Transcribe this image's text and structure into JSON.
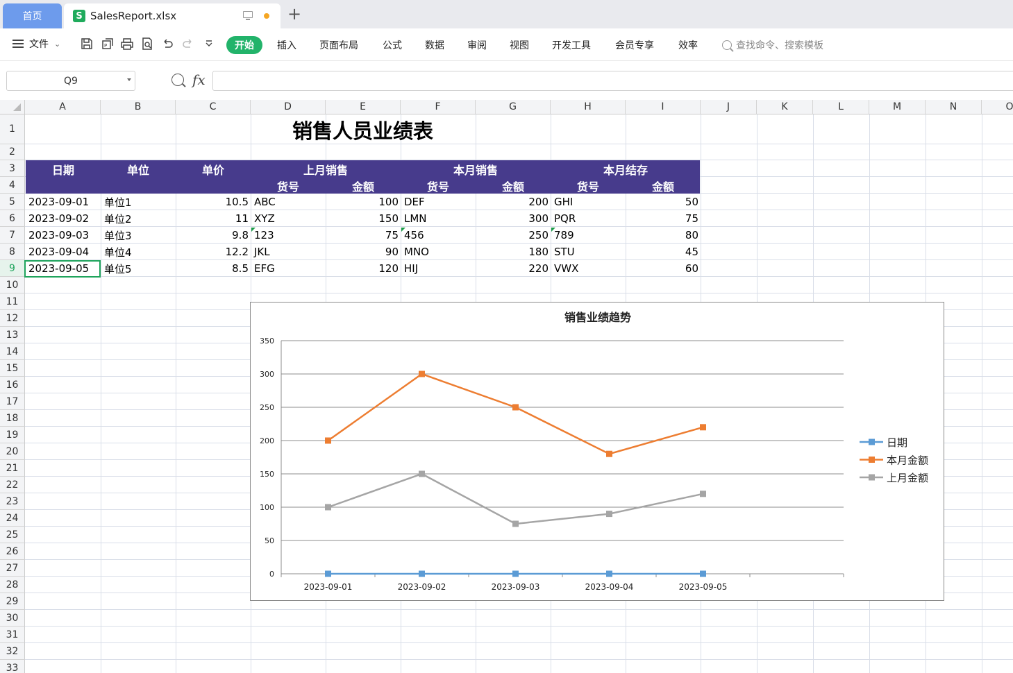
{
  "tabs": {
    "home": "首页",
    "file_name": "SalesReport.xlsx"
  },
  "menu": {
    "file": "文件"
  },
  "ribbon": [
    "开始",
    "插入",
    "页面布局",
    "公式",
    "数据",
    "审阅",
    "视图",
    "开发工具",
    "会员专享",
    "效率"
  ],
  "search": {
    "placeholder": "查找命令、搜索模板"
  },
  "formula_bar": {
    "cell_ref": "Q9",
    "fx": "fx",
    "value": ""
  },
  "columns": [
    "A",
    "B",
    "C",
    "D",
    "E",
    "F",
    "G",
    "H",
    "I",
    "J",
    "K",
    "L",
    "M",
    "N",
    "O"
  ],
  "rows": [
    "1",
    "2",
    "3",
    "4",
    "5",
    "6",
    "7",
    "8",
    "9",
    "10",
    "11",
    "12",
    "13",
    "14",
    "15",
    "16",
    "17",
    "18",
    "19",
    "20",
    "21",
    "22",
    "23",
    "24",
    "25",
    "26",
    "27",
    "28",
    "29",
    "30",
    "31",
    "32",
    "33"
  ],
  "selected_row": "9",
  "sheet": {
    "title": "销售人员业绩表",
    "header_top": {
      "date": "日期",
      "unit": "单位",
      "price": "单价",
      "last_month": "上月销售",
      "this_month": "本月销售",
      "stock": "本月结存"
    },
    "header_sub": {
      "lm_code": "货号",
      "lm_amount": "金额",
      "tm_code": "货号",
      "tm_amount": "金额",
      "st_code": "货号",
      "st_amount": "金额"
    },
    "data_rows": [
      [
        "2023-09-01",
        "单位1",
        "10.5",
        "ABC",
        "100",
        "DEF",
        "200",
        "GHI",
        "50"
      ],
      [
        "2023-09-02",
        "单位2",
        "11",
        "XYZ",
        "150",
        "LMN",
        "300",
        "PQR",
        "75"
      ],
      [
        "2023-09-03",
        "单位3",
        "9.8",
        "123",
        "75",
        "456",
        "250",
        "789",
        "80"
      ],
      [
        "2023-09-04",
        "单位4",
        "12.2",
        "JKL",
        "90",
        "MNO",
        "180",
        "STU",
        "45"
      ],
      [
        "2023-09-05",
        "单位5",
        "8.5",
        "EFG",
        "120",
        "HIJ",
        "220",
        "VWX",
        "60"
      ]
    ]
  },
  "chart_data": {
    "type": "line",
    "title": "销售业绩趋势",
    "categories": [
      "2023-09-01",
      "2023-09-02",
      "2023-09-03",
      "2023-09-04",
      "2023-09-05"
    ],
    "ylim": [
      0,
      350
    ],
    "yticks": [
      "0",
      "50",
      "100",
      "150",
      "200",
      "250",
      "300",
      "350"
    ],
    "grid": true,
    "legend_position": "right",
    "series": [
      {
        "name": "日期",
        "color": "#5b9bd5",
        "values": [
          0,
          0,
          0,
          0,
          0
        ]
      },
      {
        "name": "本月金额",
        "color": "#ed7d31",
        "values": [
          200,
          300,
          250,
          180,
          220
        ]
      },
      {
        "name": "上月金额",
        "color": "#a5a5a5",
        "values": [
          100,
          150,
          75,
          90,
          120
        ]
      }
    ]
  },
  "colors": {
    "header_band": "#473b8c",
    "active_tab": "#22b36a",
    "selection": "#1fa45c"
  }
}
